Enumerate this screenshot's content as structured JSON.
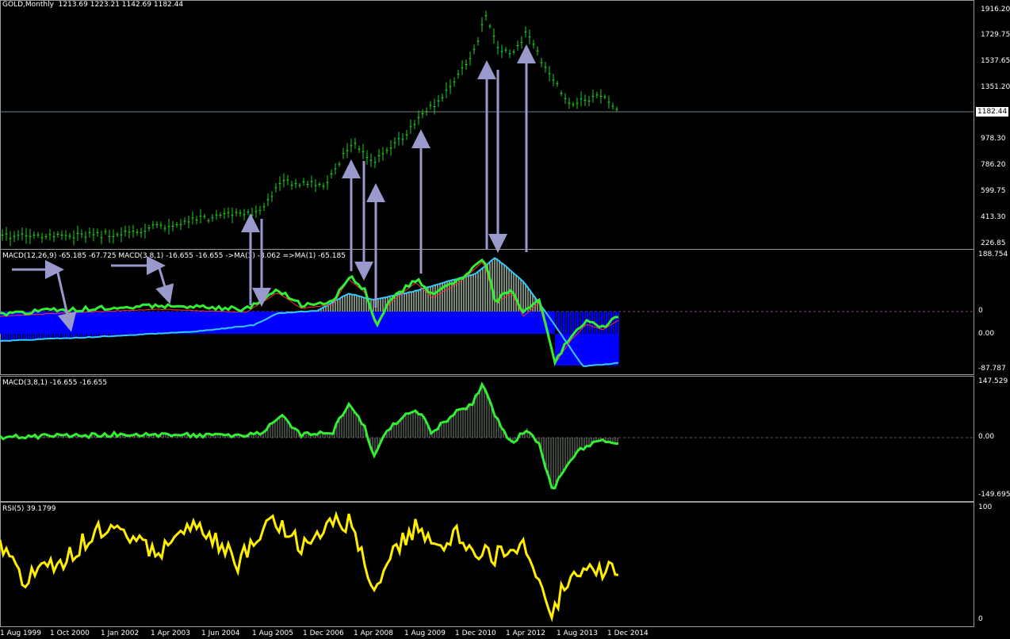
{
  "main": {
    "symbol": "GOLD,Monthly",
    "ohlc": "1213.69 1223.21 1142.69 1182.44",
    "price_levels": [
      "1916.20",
      "1729.75",
      "1537.65",
      "1351.20",
      "978.30",
      "786.20",
      "599.75",
      "413.30",
      "226.85"
    ],
    "current_price": "1182.44"
  },
  "macd_main": {
    "title": "MACD(12,26,9) -65.185 -67.725  MACD(3,8,1) -16.655 -16.655  ->MA(3) -8.062  =>MA(1) -65.185",
    "levels": [
      "188.754",
      "0",
      "0.00",
      "-87.787"
    ]
  },
  "macd_small": {
    "title": "MACD(3,8,1) -16.655 -16.655",
    "levels": [
      "147.529",
      "0.00",
      "-149.695"
    ]
  },
  "rsi": {
    "title": "RSI(5) 39.1799",
    "levels": [
      "100",
      "0"
    ]
  },
  "time_axis": [
    "1 Aug 1999",
    "1 Oct 2000",
    "1 Jan 2002",
    "1 Apr 2003",
    "1 Jun 2004",
    "1 Aug 2005",
    "1 Dec 2006",
    "1 Apr 2008",
    "1 Aug 2009",
    "1 Dec 2010",
    "1 Apr 2012",
    "1 Aug 2013",
    "1 Dec 2014"
  ],
  "colors": {
    "bars": "#22cc22",
    "macd_fast": "#33ee33",
    "signal": "#ff3030",
    "cyan": "#33ccff",
    "hist_blue": "#0000ff",
    "hist_gray": "#7a8a7a",
    "rsi": "#ffee00",
    "arrows": "#9999cc"
  },
  "chart_data": {
    "type": "line",
    "x": [
      "1999-08",
      "2000-10",
      "2002-01",
      "2003-04",
      "2004-06",
      "2005-08",
      "2006-12",
      "2008-04",
      "2009-08",
      "2010-12",
      "2012-04",
      "2013-08",
      "2014-12"
    ],
    "series": [
      {
        "name": "GOLD,Monthly",
        "values": [
          255,
          272,
          282,
          340,
          395,
          440,
          630,
          880,
          950,
          1400,
          1660,
          1320,
          1182
        ]
      }
    ],
    "ylim": [
      226.85,
      1916.2
    ]
  }
}
